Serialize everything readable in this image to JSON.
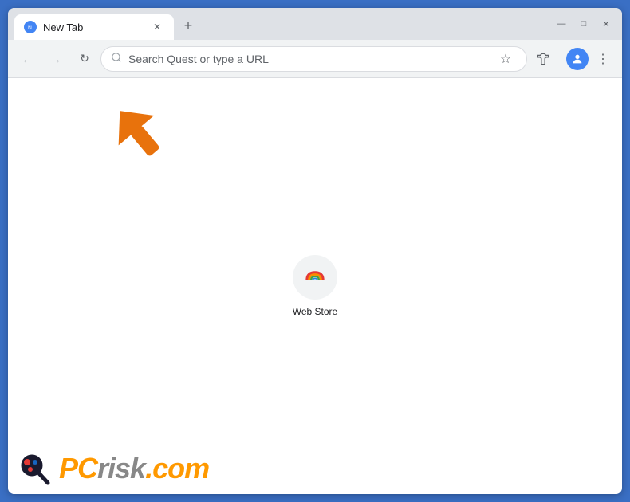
{
  "browser": {
    "title": "New Tab",
    "tab_label": "New Tab",
    "address_placeholder": "Search Quest or type a URL",
    "window_controls": {
      "minimize": "—",
      "maximize": "□",
      "close": "✕"
    }
  },
  "shortcuts": [
    {
      "id": "web-store",
      "label": "Web Store"
    }
  ],
  "watermark": {
    "brand": "PC",
    "suffix": "risk",
    "domain": ".com"
  }
}
